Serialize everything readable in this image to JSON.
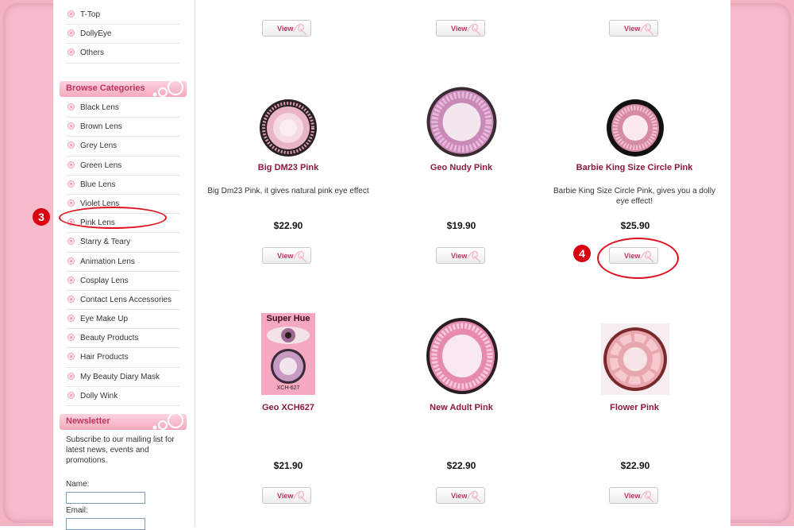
{
  "sidebar": {
    "top_items": [
      "T-Top",
      "DollyEye",
      "Others"
    ],
    "browse_title": "Browse Categories",
    "categories": [
      "Black Lens",
      "Brown Lens",
      "Grey Lens",
      "Green Lens",
      "Blue Lens",
      "Violet Lens",
      "Pink Lens",
      "Starry & Teary",
      "Animation Lens",
      "Cosplay Lens",
      "Contact Lens Accessories",
      "Eye Make Up",
      "Beauty Products",
      "Hair Products",
      "My Beauty Diary Mask",
      "Dolly Wink"
    ],
    "newsletter_title": "Newsletter",
    "newsletter_text": "Subscribe to our mailing list for latest news, events and promotions.",
    "name_label": "Name:",
    "email_label": "Email:"
  },
  "view_label": "View",
  "products": [
    {
      "name": "Big DM23 Pink",
      "desc": "Big Dm23 Pink, it gives natural pink eye effect",
      "price": "$22.90"
    },
    {
      "name": "Geo Nudy Pink",
      "desc": "",
      "price": "$19.90"
    },
    {
      "name": "Barbie King Size Circle Pink",
      "desc": "Barbie King Size Circle Pink, gives you a dolly eye effect!",
      "price": "$25.90"
    },
    {
      "name": "Geo XCH627",
      "desc": "",
      "price": "$21.90"
    },
    {
      "name": "New Adult Pink",
      "desc": "",
      "price": "$22.90"
    },
    {
      "name": "Flower Pink",
      "desc": "",
      "price": "$22.90"
    }
  ],
  "superhue_box": {
    "title": "Super Hue",
    "code": "XCH-627"
  },
  "annotations": {
    "step3": "3",
    "step4": "4"
  },
  "colors": {
    "accent": "#c0345d",
    "name": "#8b1a3c",
    "frame": "#f3b3c3",
    "annotation": "#d9000f"
  }
}
